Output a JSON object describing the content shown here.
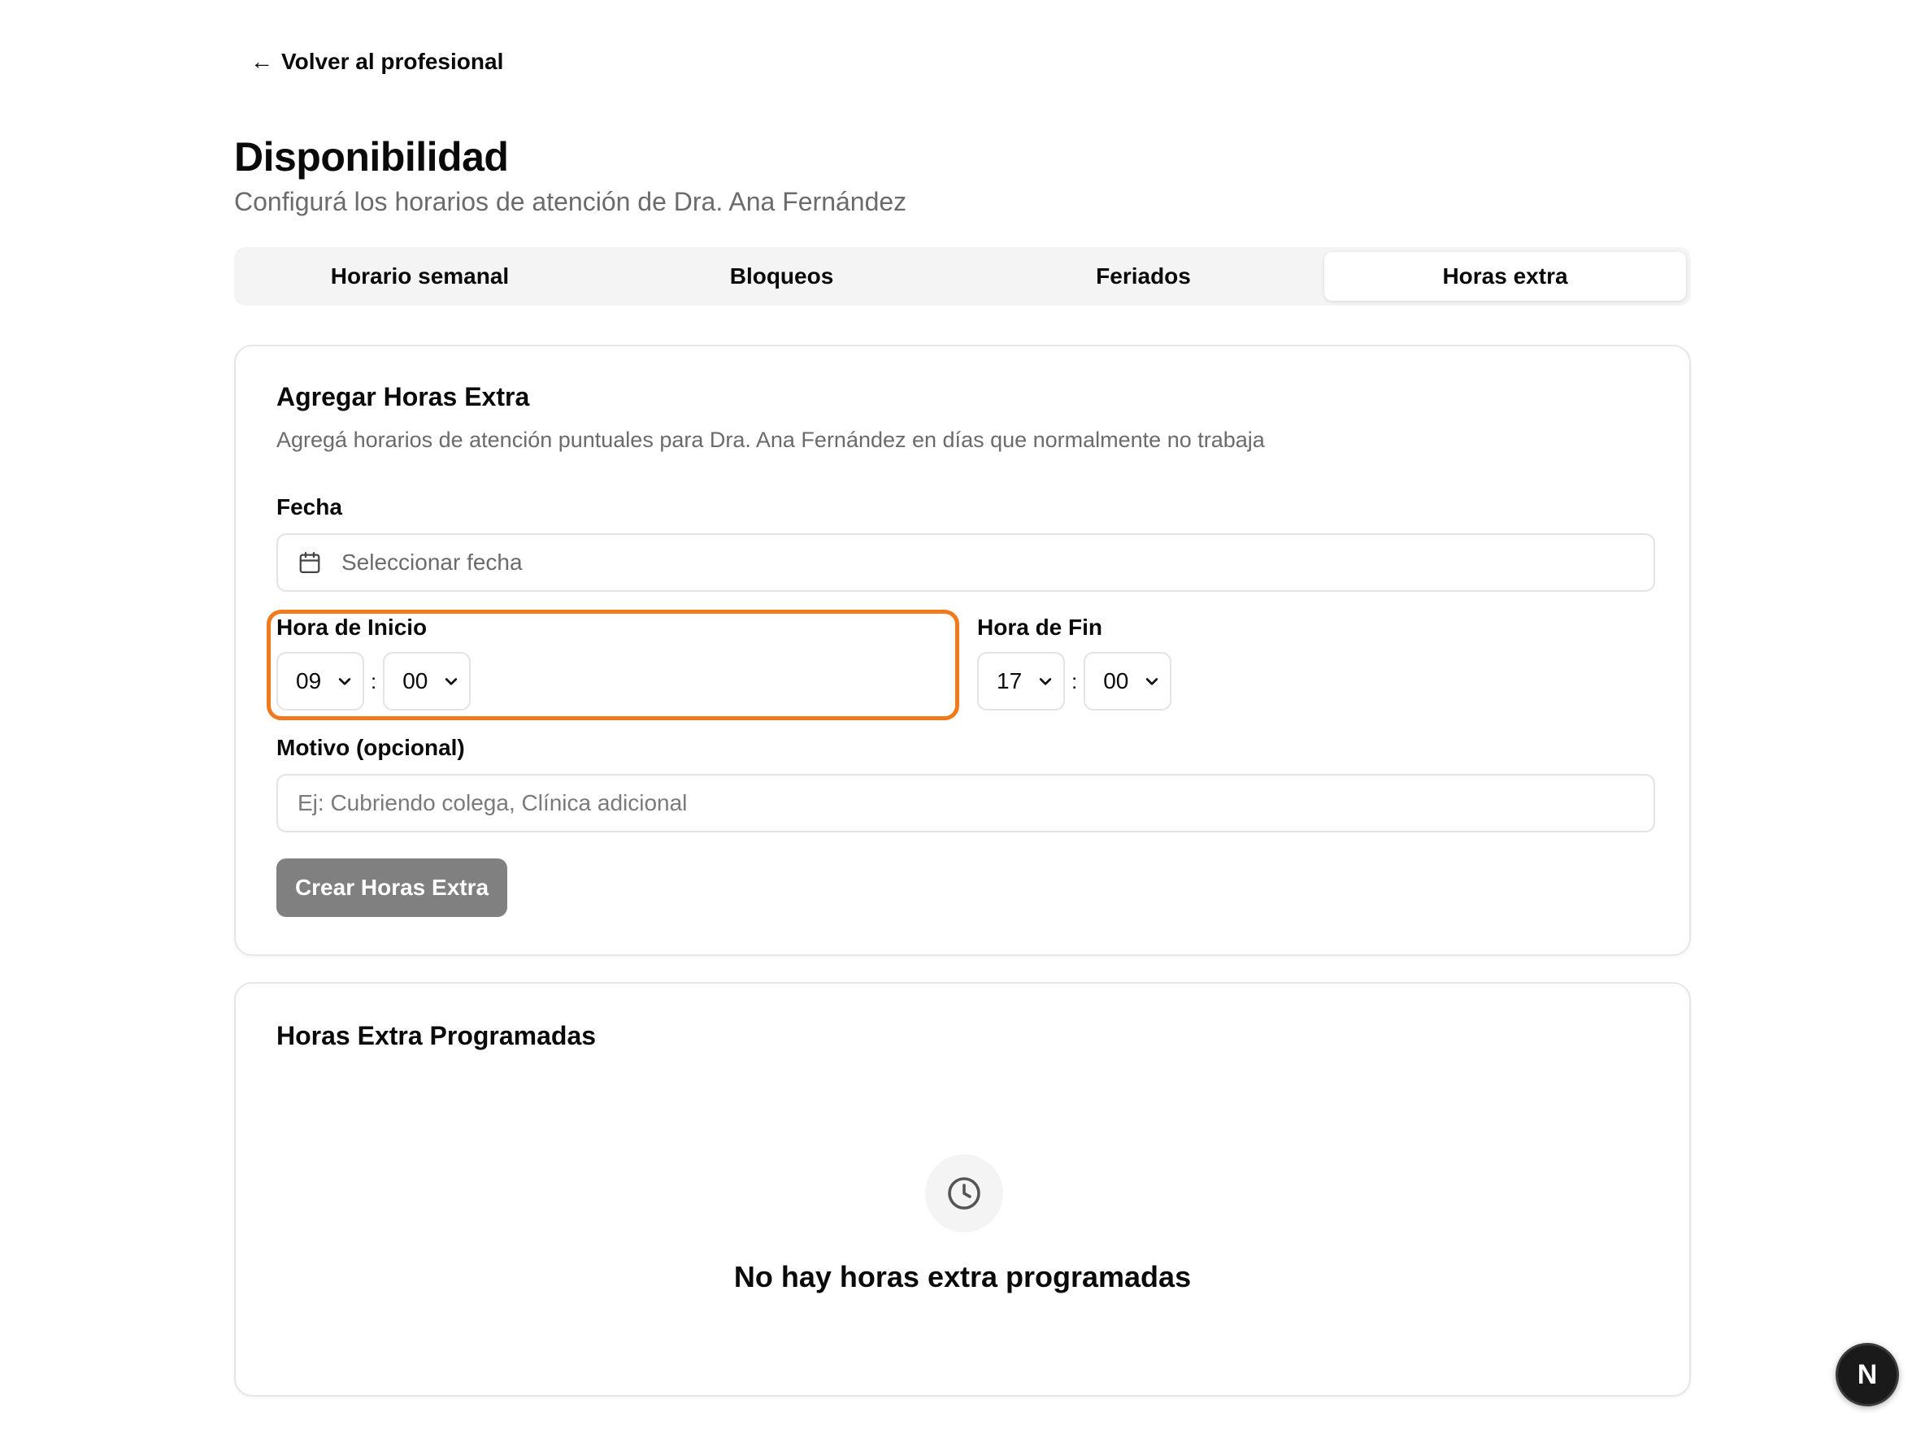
{
  "nav": {
    "back_arrow": "←",
    "back_label": "Volver al profesional"
  },
  "header": {
    "title": "Disponibilidad",
    "subtitle": "Configurá los horarios de atención de Dra. Ana Fernández"
  },
  "tabs": [
    {
      "label": "Horario semanal",
      "active": false
    },
    {
      "label": "Bloqueos",
      "active": false
    },
    {
      "label": "Feriados",
      "active": false
    },
    {
      "label": "Horas extra",
      "active": true
    }
  ],
  "add_form": {
    "title": "Agregar Horas Extra",
    "description": "Agregá horarios de atención puntuales para Dra. Ana Fernández en días que normalmente no trabaja",
    "date_label": "Fecha",
    "date_placeholder": "Seleccionar fecha",
    "date_icon": "calendar-icon",
    "start_label": "Hora de Inicio",
    "start_hour": "09",
    "start_minute": "00",
    "end_label": "Hora de Fin",
    "end_hour": "17",
    "end_minute": "00",
    "time_separator": ":",
    "reason_label": "Motivo (opcional)",
    "reason_placeholder": "Ej: Cubriendo colega, Clínica adicional",
    "submit_label": "Crear Horas Extra"
  },
  "scheduled": {
    "title": "Horas Extra Programadas",
    "empty_icon": "clock-icon",
    "empty_message": "No hay horas extra programadas"
  },
  "badge": {
    "letter": "N"
  },
  "colors": {
    "highlight": "#f07a1c",
    "submit_bg": "#808080",
    "tab_bg": "#f4f4f5",
    "muted_text": "#6b6b6b"
  }
}
